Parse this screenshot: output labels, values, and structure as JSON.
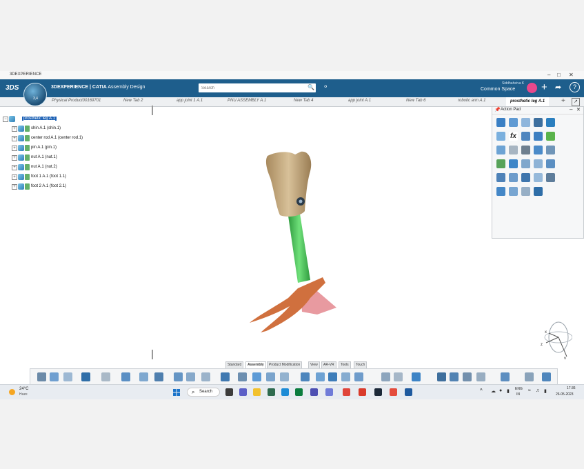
{
  "window": {
    "title": "3DEXPERIENCE"
  },
  "header": {
    "brand_logo": "3DS",
    "compass_label": "3,4",
    "app_brand": "3DEXPERIENCE | CATIA",
    "app_name": "Assembly Design",
    "search_placeholder": "Search",
    "user": "Siddhaheiva K",
    "space": "Common Space"
  },
  "tabs": [
    {
      "label": "Physical Product00169701"
    },
    {
      "label": "New Tab 2"
    },
    {
      "label": "app joint 1 A.1"
    },
    {
      "label": "PNU ASSEMBLY A.1"
    },
    {
      "label": "New Tab 4"
    },
    {
      "label": "app joint A.1"
    },
    {
      "label": "New Tab 6"
    },
    {
      "label": "robotic arm A.1"
    },
    {
      "label": "prosthetic leg A.1"
    }
  ],
  "tree": {
    "root": "prosthetic leg A.1",
    "items": [
      {
        "label": "shin A.1 (shin.1)"
      },
      {
        "label": "center rod A.1 (center rod.1)"
      },
      {
        "label": "pin A.1 (pin.1)"
      },
      {
        "label": "nut A.1 (nut.1)"
      },
      {
        "label": "nut A.1 (nut.2)"
      },
      {
        "label": "foot 1 A.1 (foot 1.1)"
      },
      {
        "label": "foot 2 A.1 (foot 2.1)"
      }
    ]
  },
  "action_pad": {
    "title": "Action Pad"
  },
  "section_tabs": [
    {
      "label": "Standard"
    },
    {
      "label": "Assembly"
    },
    {
      "label": "Product Modification"
    },
    {
      "label": "View"
    },
    {
      "label": "AR-VR"
    },
    {
      "label": "Tools"
    },
    {
      "label": "Touch"
    }
  ],
  "taskbar": {
    "temp": "24°C",
    "weather": "Haze",
    "search_label": "Search",
    "lang1": "ENG",
    "lang2": "IN",
    "time": "17:36",
    "date": "26-05-2023"
  },
  "colors": {
    "header": "#1e5e8c",
    "socket": "#c2a77d",
    "pylon": "#4bc45a",
    "foot": "#d0703e",
    "foot_base": "#e89aa0"
  }
}
